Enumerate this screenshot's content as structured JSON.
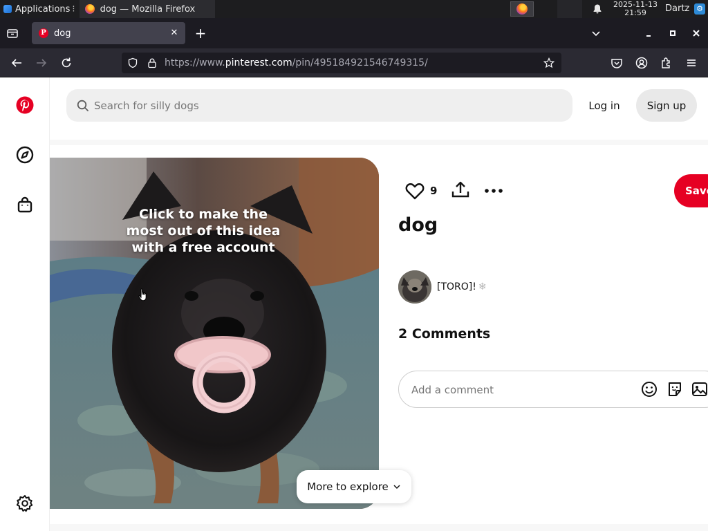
{
  "taskbar": {
    "apps_label": "Applications",
    "task_title": "dog — Mozilla Firefox",
    "clock_date": "2025-11-13",
    "clock_time": "21:59",
    "user": "Dartz"
  },
  "browser": {
    "tab_title": "dog",
    "url_prefix": "https://www.",
    "url_host": "pinterest.com",
    "url_path": "/pin/495184921546749315/"
  },
  "header": {
    "search_placeholder": "Search for silly dogs",
    "login_label": "Log in",
    "signup_label": "Sign up"
  },
  "pin": {
    "overlay_text": "Click to make the most out of this idea with a free account",
    "like_count": "9",
    "save_label": "Save",
    "title": "dog",
    "author": "[TORO]!",
    "author_badge": "❄",
    "comments_heading": "2 Comments",
    "comment_placeholder": "Add a comment"
  },
  "explore": {
    "label": "More to explore"
  },
  "colors": {
    "brand": "#e60023",
    "chrome_dark": "#1c1b22",
    "toolbar": "#2b2a33"
  }
}
